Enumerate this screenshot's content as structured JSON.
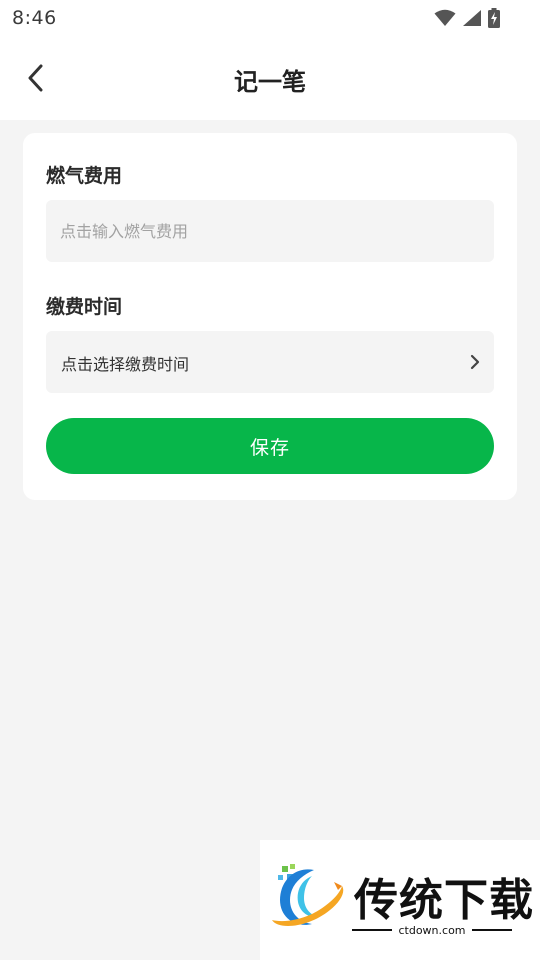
{
  "status_bar": {
    "time": "8:46",
    "icons": [
      "wifi-icon",
      "signal-icon",
      "battery-charging-icon"
    ]
  },
  "header": {
    "title": "记一笔",
    "back_icon": "chevron-left-icon"
  },
  "form": {
    "gas_label": "燃气费用",
    "gas_placeholder": "点击输入燃气费用",
    "gas_value": "",
    "date_label": "缴费时间",
    "date_value": "点击选择缴费时间",
    "date_icon": "chevron-right-icon",
    "save_label": "保存"
  },
  "watermark": {
    "brand": "传统下载",
    "url": "ctdown.com"
  },
  "colors": {
    "accent": "#07b64a",
    "background": "#f4f4f4",
    "card": "#ffffff",
    "field_bg": "#f4f4f4",
    "placeholder": "#a2a2a2"
  }
}
